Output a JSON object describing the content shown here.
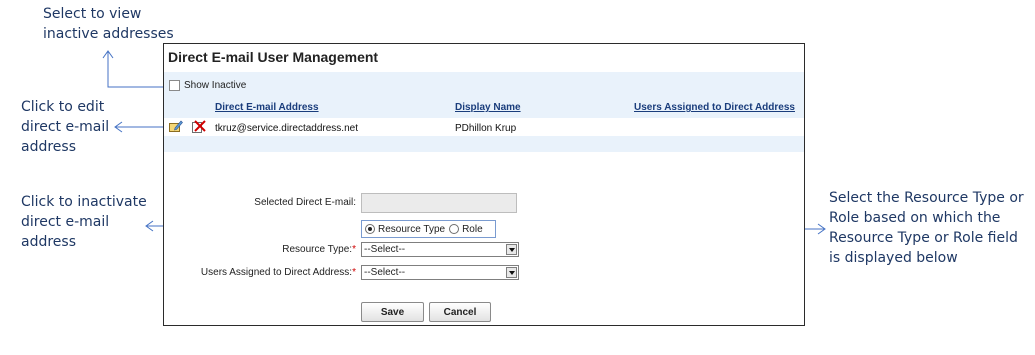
{
  "callouts": {
    "show_inactive": "Select to view\ninactive addresses",
    "edit": "Click to edit\ndirect e-mail\naddress",
    "inactivate": "Click to inactivate\ndirect e-mail\naddress",
    "resource_role": "Select the Resource Type or\nRole based on which the\nResource Type or Role field\nis displayed below"
  },
  "panel": {
    "title": "Direct E-mail User Management",
    "show_inactive_label": "Show Inactive",
    "show_inactive_checked": false,
    "columns": [
      "Direct E-mail Address",
      "Display Name",
      "Users Assigned to Direct Address"
    ],
    "rows": [
      {
        "email": "tkruz@service.directaddress.net",
        "display_name": "PDhillon Krup",
        "users_assigned": ""
      }
    ]
  },
  "form": {
    "selected_email_label": "Selected Direct E-mail:",
    "selected_email_value": "",
    "radio_options": [
      "Resource Type",
      "Role"
    ],
    "radio_selected": "Resource Type",
    "resource_type_label": "Resource Type:",
    "resource_type_value": "--Select--",
    "users_assigned_label": "Users Assigned to Direct Address:",
    "users_assigned_value": "--Select--",
    "required_marker": "*",
    "save_label": "Save",
    "cancel_label": "Cancel"
  },
  "colors": {
    "annotation_text": "#1f3864",
    "annotation_line": "#4472c4",
    "header_link": "#1a3d7c",
    "band": "#e9f2fb",
    "required": "#d00000"
  }
}
